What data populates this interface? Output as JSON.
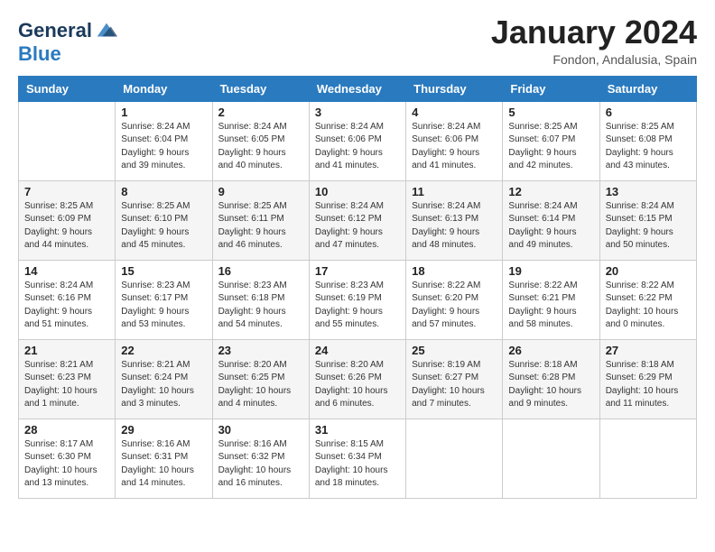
{
  "logo": {
    "line1": "General",
    "line2": "Blue"
  },
  "title": "January 2024",
  "subtitle": "Fondon, Andalusia, Spain",
  "columns": [
    "Sunday",
    "Monday",
    "Tuesday",
    "Wednesday",
    "Thursday",
    "Friday",
    "Saturday"
  ],
  "weeks": [
    [
      {
        "day": "",
        "sunrise": "",
        "sunset": "",
        "daylight": ""
      },
      {
        "day": "1",
        "sunrise": "Sunrise: 8:24 AM",
        "sunset": "Sunset: 6:04 PM",
        "daylight": "Daylight: 9 hours and 39 minutes."
      },
      {
        "day": "2",
        "sunrise": "Sunrise: 8:24 AM",
        "sunset": "Sunset: 6:05 PM",
        "daylight": "Daylight: 9 hours and 40 minutes."
      },
      {
        "day": "3",
        "sunrise": "Sunrise: 8:24 AM",
        "sunset": "Sunset: 6:06 PM",
        "daylight": "Daylight: 9 hours and 41 minutes."
      },
      {
        "day": "4",
        "sunrise": "Sunrise: 8:24 AM",
        "sunset": "Sunset: 6:06 PM",
        "daylight": "Daylight: 9 hours and 41 minutes."
      },
      {
        "day": "5",
        "sunrise": "Sunrise: 8:25 AM",
        "sunset": "Sunset: 6:07 PM",
        "daylight": "Daylight: 9 hours and 42 minutes."
      },
      {
        "day": "6",
        "sunrise": "Sunrise: 8:25 AM",
        "sunset": "Sunset: 6:08 PM",
        "daylight": "Daylight: 9 hours and 43 minutes."
      }
    ],
    [
      {
        "day": "7",
        "sunrise": "Sunrise: 8:25 AM",
        "sunset": "Sunset: 6:09 PM",
        "daylight": "Daylight: 9 hours and 44 minutes."
      },
      {
        "day": "8",
        "sunrise": "Sunrise: 8:25 AM",
        "sunset": "Sunset: 6:10 PM",
        "daylight": "Daylight: 9 hours and 45 minutes."
      },
      {
        "day": "9",
        "sunrise": "Sunrise: 8:25 AM",
        "sunset": "Sunset: 6:11 PM",
        "daylight": "Daylight: 9 hours and 46 minutes."
      },
      {
        "day": "10",
        "sunrise": "Sunrise: 8:24 AM",
        "sunset": "Sunset: 6:12 PM",
        "daylight": "Daylight: 9 hours and 47 minutes."
      },
      {
        "day": "11",
        "sunrise": "Sunrise: 8:24 AM",
        "sunset": "Sunset: 6:13 PM",
        "daylight": "Daylight: 9 hours and 48 minutes."
      },
      {
        "day": "12",
        "sunrise": "Sunrise: 8:24 AM",
        "sunset": "Sunset: 6:14 PM",
        "daylight": "Daylight: 9 hours and 49 minutes."
      },
      {
        "day": "13",
        "sunrise": "Sunrise: 8:24 AM",
        "sunset": "Sunset: 6:15 PM",
        "daylight": "Daylight: 9 hours and 50 minutes."
      }
    ],
    [
      {
        "day": "14",
        "sunrise": "Sunrise: 8:24 AM",
        "sunset": "Sunset: 6:16 PM",
        "daylight": "Daylight: 9 hours and 51 minutes."
      },
      {
        "day": "15",
        "sunrise": "Sunrise: 8:23 AM",
        "sunset": "Sunset: 6:17 PM",
        "daylight": "Daylight: 9 hours and 53 minutes."
      },
      {
        "day": "16",
        "sunrise": "Sunrise: 8:23 AM",
        "sunset": "Sunset: 6:18 PM",
        "daylight": "Daylight: 9 hours and 54 minutes."
      },
      {
        "day": "17",
        "sunrise": "Sunrise: 8:23 AM",
        "sunset": "Sunset: 6:19 PM",
        "daylight": "Daylight: 9 hours and 55 minutes."
      },
      {
        "day": "18",
        "sunrise": "Sunrise: 8:22 AM",
        "sunset": "Sunset: 6:20 PM",
        "daylight": "Daylight: 9 hours and 57 minutes."
      },
      {
        "day": "19",
        "sunrise": "Sunrise: 8:22 AM",
        "sunset": "Sunset: 6:21 PM",
        "daylight": "Daylight: 9 hours and 58 minutes."
      },
      {
        "day": "20",
        "sunrise": "Sunrise: 8:22 AM",
        "sunset": "Sunset: 6:22 PM",
        "daylight": "Daylight: 10 hours and 0 minutes."
      }
    ],
    [
      {
        "day": "21",
        "sunrise": "Sunrise: 8:21 AM",
        "sunset": "Sunset: 6:23 PM",
        "daylight": "Daylight: 10 hours and 1 minute."
      },
      {
        "day": "22",
        "sunrise": "Sunrise: 8:21 AM",
        "sunset": "Sunset: 6:24 PM",
        "daylight": "Daylight: 10 hours and 3 minutes."
      },
      {
        "day": "23",
        "sunrise": "Sunrise: 8:20 AM",
        "sunset": "Sunset: 6:25 PM",
        "daylight": "Daylight: 10 hours and 4 minutes."
      },
      {
        "day": "24",
        "sunrise": "Sunrise: 8:20 AM",
        "sunset": "Sunset: 6:26 PM",
        "daylight": "Daylight: 10 hours and 6 minutes."
      },
      {
        "day": "25",
        "sunrise": "Sunrise: 8:19 AM",
        "sunset": "Sunset: 6:27 PM",
        "daylight": "Daylight: 10 hours and 7 minutes."
      },
      {
        "day": "26",
        "sunrise": "Sunrise: 8:18 AM",
        "sunset": "Sunset: 6:28 PM",
        "daylight": "Daylight: 10 hours and 9 minutes."
      },
      {
        "day": "27",
        "sunrise": "Sunrise: 8:18 AM",
        "sunset": "Sunset: 6:29 PM",
        "daylight": "Daylight: 10 hours and 11 minutes."
      }
    ],
    [
      {
        "day": "28",
        "sunrise": "Sunrise: 8:17 AM",
        "sunset": "Sunset: 6:30 PM",
        "daylight": "Daylight: 10 hours and 13 minutes."
      },
      {
        "day": "29",
        "sunrise": "Sunrise: 8:16 AM",
        "sunset": "Sunset: 6:31 PM",
        "daylight": "Daylight: 10 hours and 14 minutes."
      },
      {
        "day": "30",
        "sunrise": "Sunrise: 8:16 AM",
        "sunset": "Sunset: 6:32 PM",
        "daylight": "Daylight: 10 hours and 16 minutes."
      },
      {
        "day": "31",
        "sunrise": "Sunrise: 8:15 AM",
        "sunset": "Sunset: 6:34 PM",
        "daylight": "Daylight: 10 hours and 18 minutes."
      },
      {
        "day": "",
        "sunrise": "",
        "sunset": "",
        "daylight": ""
      },
      {
        "day": "",
        "sunrise": "",
        "sunset": "",
        "daylight": ""
      },
      {
        "day": "",
        "sunrise": "",
        "sunset": "",
        "daylight": ""
      }
    ]
  ]
}
